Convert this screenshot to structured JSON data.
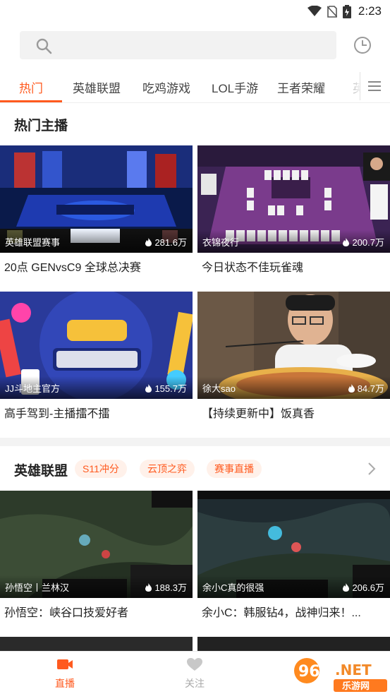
{
  "status_bar": {
    "time": "2:23"
  },
  "search": {
    "placeholder": ""
  },
  "tabs": [
    {
      "label": "热门",
      "active": true
    },
    {
      "label": "英雄联盟"
    },
    {
      "label": "吃鸡游戏"
    },
    {
      "label": "LOL手游"
    },
    {
      "label": "王者荣耀"
    },
    {
      "label": "英"
    }
  ],
  "hot_section": {
    "title": "热门主播",
    "cards": [
      {
        "name": "英雄联盟赛事",
        "views": "281.6万",
        "title": "20点 GENvsC9 全球总决赛"
      },
      {
        "name": "衣锦夜行",
        "views": "200.7万",
        "title": "今日状态不佳玩雀魂"
      },
      {
        "name": "JJ斗地主官方",
        "views": "155.7万",
        "title": "高手驾到-主播擂不擂"
      },
      {
        "name": "徐大sao",
        "views": "84.7万",
        "title": "【持续更新中】饭真香"
      }
    ]
  },
  "lol_section": {
    "title": "英雄联盟",
    "tags": [
      "S11冲分",
      "云顶之弈",
      "赛事直播"
    ],
    "cards": [
      {
        "name": "孙悟空丨兰林汉",
        "views": "188.3万",
        "title": "孙悟空：峡谷口技爱好者"
      },
      {
        "name": "余小C真的很强",
        "views": "206.6万",
        "title": "余小C：韩服钻4，战神归来！..."
      }
    ]
  },
  "bottom_nav": [
    {
      "label": "直播",
      "active": true
    },
    {
      "label": "关注"
    }
  ],
  "watermark": {
    "text": "962.NET",
    "subtext": "乐游网"
  },
  "colors": {
    "accent": "#ff5a1f",
    "tag_bg": "#fff1ea"
  }
}
